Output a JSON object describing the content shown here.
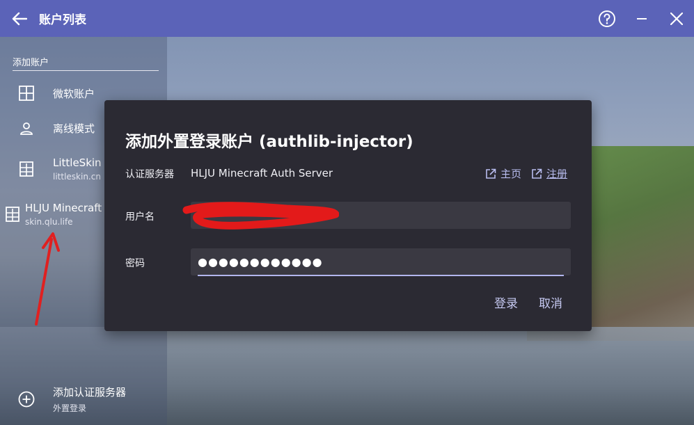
{
  "window": {
    "title": "账户列表"
  },
  "sidebar": {
    "heading": "添加账户",
    "items": [
      {
        "label": "微软账户",
        "icon": "microsoft-icon"
      },
      {
        "label": "离线模式",
        "icon": "person-icon"
      },
      {
        "label": "LittleSkin",
        "sub": "littleskin.cn",
        "icon": "server-icon"
      },
      {
        "label": "HLJU Minecraft Auth Server",
        "sub": "skin.qlu.life",
        "icon": "server-icon"
      }
    ],
    "footer": {
      "label": "添加认证服务器",
      "sub": "外置登录",
      "icon": "add-circle-icon"
    }
  },
  "dialog": {
    "title": "添加外置登录账户 (authlib-injector)",
    "server_label": "认证服务器",
    "server_name": "HLJU Minecraft Auth Server",
    "homepage_link": "主页",
    "register_link": "注册",
    "username_label": "用户名",
    "username_value": "",
    "password_label": "密码",
    "password_value": "●●●●●●●●●●●●",
    "login_button": "登录",
    "cancel_button": "取消"
  },
  "colors": {
    "titlebar": "#5b63b8",
    "dialog_bg": "#2b2a33",
    "accent": "#b9bdf0",
    "annotation": "#e02020"
  }
}
